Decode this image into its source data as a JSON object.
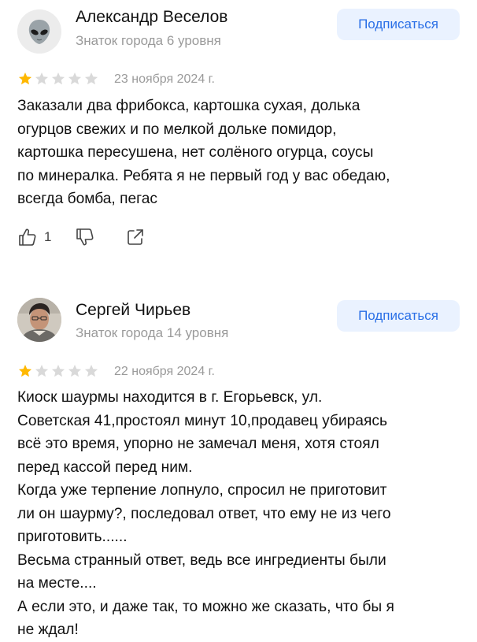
{
  "reviews": [
    {
      "author": "Александр Веселов",
      "level": "Знаток города 6 уровня",
      "avatar_icon": "alien-icon",
      "subscribe_label": "Подписаться",
      "rating": 1,
      "rating_max": 5,
      "date": "23 ноября 2024 г.",
      "text_lines": [
        "Заказали два фрибокса, картошка сухая, долька",
        "огурцов свежих и по мелкой дольке  помидор,",
        "картошка пересушена,  нет солёного огурца, соусы",
        "по минералка. Ребята я не первый год у вас обедаю,",
        "всегда бомба, пегас"
      ],
      "likes": "1",
      "actions": [
        "thumbs-up-icon",
        "thumbs-down-icon",
        "share-icon"
      ]
    },
    {
      "author": "Сергей Чирьев",
      "level": "Знаток города 14 уровня",
      "avatar_icon": "user-photo",
      "subscribe_label": "Подписаться",
      "rating": 1,
      "rating_max": 5,
      "date": "22 ноября 2024 г.",
      "text_lines": [
        "Киоск шаурмы находится в г. Егорьевск, ул.",
        "Советская 41,простоял минут 10,продавец убираясь",
        "всё это время, упорно не замечал меня, хотя стоял",
        "перед кассой перед ним.",
        "Когда уже терпение лопнуло, спросил не приготовит",
        "ли он шаурму?, последовал ответ, что ему не из чего",
        "приготовить......",
        "Весьма странный ответ, ведь все ингредиенты были",
        "на месте....",
        "А если это, и даже так, то можно же сказать, что бы я",
        "не ждал!"
      ]
    }
  ],
  "colors": {
    "star_filled": "#FFB800",
    "star_empty": "#D9D9D9",
    "subscribe_bg": "#EAF2FF",
    "subscribe_text": "#2A6FE6",
    "muted_text": "#9A9A9A"
  }
}
